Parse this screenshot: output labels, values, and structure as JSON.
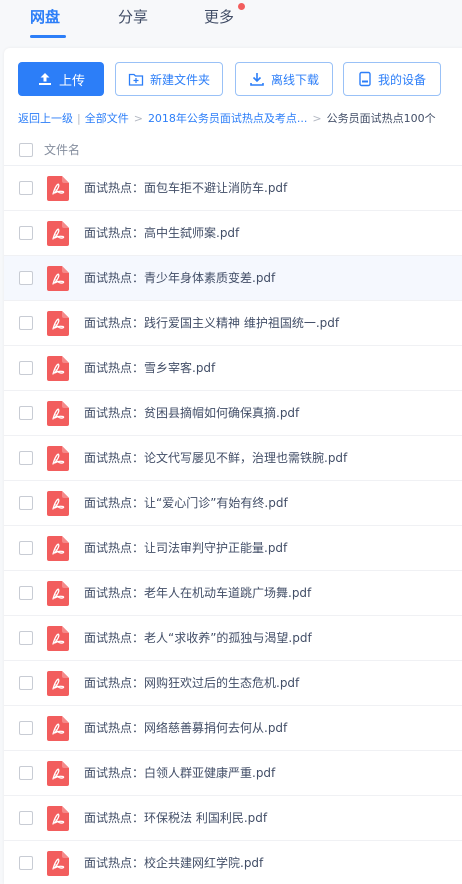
{
  "tabs": [
    {
      "label": "网盘",
      "active": true
    },
    {
      "label": "分享",
      "active": false
    },
    {
      "label": "更多",
      "active": false
    }
  ],
  "toolbar": {
    "upload_label": "上传",
    "new_folder_label": "新建文件夹",
    "offline_download_label": "离线下载",
    "my_devices_label": "我的设备"
  },
  "breadcrumb": {
    "back_label": "返回上一级",
    "all_files_label": "全部文件",
    "parent_folder": "2018年公务员面试热点及考点...",
    "current_folder": "公务员面试热点100个"
  },
  "list_header": {
    "filename_label": "文件名"
  },
  "files": [
    {
      "name": "面试热点：面包车拒不避让消防车.pdf"
    },
    {
      "name": "面试热点：高中生弑师案.pdf"
    },
    {
      "name": "面试热点：青少年身体素质变差.pdf"
    },
    {
      "name": "面试热点：践行爱国主义精神 维护祖国统一.pdf"
    },
    {
      "name": "面试热点：雪乡宰客.pdf"
    },
    {
      "name": "面试热点：贫困县摘帽如何确保真摘.pdf"
    },
    {
      "name": "面试热点：论文代写屡见不鲜，治理也需铁腕.pdf"
    },
    {
      "name": "面试热点：让“爱心门诊”有始有终.pdf"
    },
    {
      "name": "面试热点：让司法审判守护正能量.pdf"
    },
    {
      "name": "面试热点：老年人在机动车道跳广场舞.pdf"
    },
    {
      "name": "面试热点：老人“求收养”的孤独与渴望.pdf"
    },
    {
      "name": "面试热点：网购狂欢过后的生态危机.pdf"
    },
    {
      "name": "面试热点：网络慈善募捐何去何从.pdf"
    },
    {
      "name": "面试热点：白领人群亚健康严重.pdf"
    },
    {
      "name": "面试热点：环保税法 利国利民.pdf"
    },
    {
      "name": "面试热点：校企共建网红学院.pdf"
    }
  ],
  "colors": {
    "accent": "#2c7ef8",
    "pdf_red": "#f25d5d",
    "text": "#424e67",
    "notification_dot": "#f25d5d"
  },
  "icons": {
    "upload": "upload-icon",
    "new_folder": "folder-plus-icon",
    "offline_download": "download-icon",
    "devices": "device-icon",
    "file": "pdf-file-icon"
  }
}
